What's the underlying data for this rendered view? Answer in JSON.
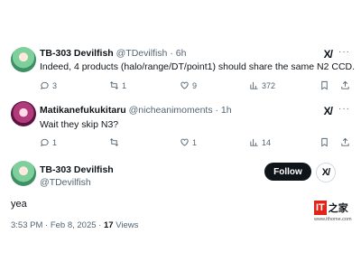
{
  "replies": [
    {
      "name": "TB-303 Devilfish",
      "handle": "@TDevilfish",
      "time": "· 6h",
      "text": "Indeed, 4 products (halo/range/DT/point1) should share the same N2 CCD.",
      "replies": "3",
      "reposts": "1",
      "likes": "9",
      "views": "372"
    },
    {
      "name": "Matikanefukukitaru",
      "handle": "@nicheanimoments",
      "time": "· 1h",
      "text": "Wait they skip N3?",
      "replies": "1",
      "reposts": "",
      "likes": "1",
      "views": "14"
    }
  ],
  "main": {
    "name": "TB-303 Devilfish",
    "handle": "@TDevilfish",
    "follow_label": "Follow",
    "text": "yea",
    "date": "3:53 PM · Feb 8, 2025 · ",
    "views_count": "17",
    "views_label": " Views"
  },
  "watermark": {
    "logo": "IT",
    "zh": "之家",
    "url": "www.ithome.com"
  },
  "icons": [
    "more-icon",
    "grok-icon",
    "reply-icon",
    "repost-icon",
    "like-icon",
    "views-icon",
    "bookmark-icon",
    "share-icon"
  ]
}
